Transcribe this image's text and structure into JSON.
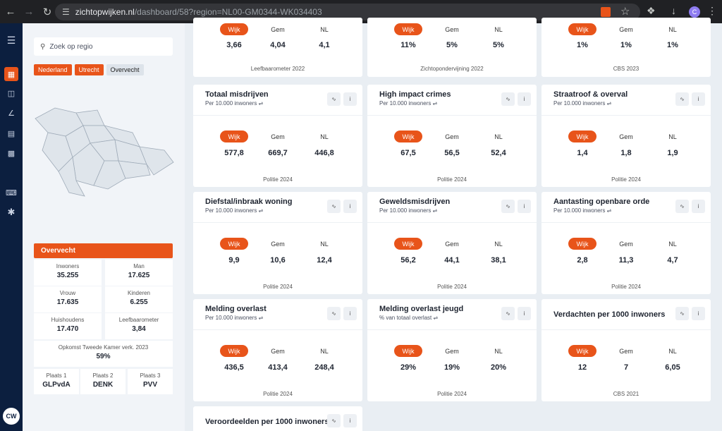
{
  "browser": {
    "url_host": "zichtopwijken.nl",
    "url_path": "/dashboard/58?region=NL00-GM0344-WK034403",
    "profile_initial": "C"
  },
  "rail": {
    "avatar": "CW"
  },
  "sidebar": {
    "search_placeholder": "Zoek op regio",
    "breadcrumbs": [
      "Nederland",
      "Utrecht",
      "Overvecht"
    ],
    "region_title": "Overvecht",
    "stats": [
      {
        "label": "Inwoners",
        "value": "35.255"
      },
      {
        "label": "Man",
        "value": "17.625"
      },
      {
        "label": "Vrouw",
        "value": "17.635"
      },
      {
        "label": "Kinderen",
        "value": "6.255"
      },
      {
        "label": "Huishoudens",
        "value": "17.470"
      },
      {
        "label": "Leefbaarometer",
        "value": "3,84"
      }
    ],
    "election": {
      "label": "Opkomst Tweede Kamer verk. 2023",
      "value": "59%"
    },
    "places": [
      {
        "label": "Plaats 1",
        "value": "GLPvdA"
      },
      {
        "label": "Plaats 2",
        "value": "DENK"
      },
      {
        "label": "Plaats 3",
        "value": "PVV"
      }
    ]
  },
  "columns": {
    "wijk": "Wijk",
    "gem": "Gem",
    "nl": "NL"
  },
  "cards": [
    {
      "title": "",
      "subtitle": "",
      "wijk": "3,66",
      "gem": "4,04",
      "nl": "4,1",
      "source": "Leefbaarometer 2022"
    },
    {
      "title": "",
      "subtitle": "",
      "wijk": "11%",
      "gem": "5%",
      "nl": "5%",
      "source": "Zichtopondervijning 2022"
    },
    {
      "title": "",
      "subtitle": "",
      "wijk": "1%",
      "gem": "1%",
      "nl": "1%",
      "source": "CBS 2023"
    },
    {
      "title": "Totaal misdrijven",
      "subtitle": "Per 10.000 inwoners",
      "wijk": "577,8",
      "gem": "669,7",
      "nl": "446,8",
      "source": "Politie 2024"
    },
    {
      "title": "High impact crimes",
      "subtitle": "Per 10.000 inwoners",
      "wijk": "67,5",
      "gem": "56,5",
      "nl": "52,4",
      "source": "Politie 2024"
    },
    {
      "title": "Straatroof & overval",
      "subtitle": "Per 10.000 inwoners",
      "wijk": "1,4",
      "gem": "1,8",
      "nl": "1,9",
      "source": "Politie 2024"
    },
    {
      "title": "Diefstal/inbraak woning",
      "subtitle": "Per 10.000 inwoners",
      "wijk": "9,9",
      "gem": "10,6",
      "nl": "12,4",
      "source": "Politie 2024"
    },
    {
      "title": "Geweldsmisdrijven",
      "subtitle": "Per 10.000 inwoners",
      "wijk": "56,2",
      "gem": "44,1",
      "nl": "38,1",
      "source": "Politie 2024"
    },
    {
      "title": "Aantasting openbare orde",
      "subtitle": "Per 10.000 inwoners",
      "wijk": "2,8",
      "gem": "11,3",
      "nl": "4,7",
      "source": "Politie 2024"
    },
    {
      "title": "Melding overlast",
      "subtitle": "Per 10.000 inwoners",
      "wijk": "436,5",
      "gem": "413,4",
      "nl": "248,4",
      "source": "Politie 2024"
    },
    {
      "title": "Melding overlast jeugd",
      "subtitle": "% van totaal overlast",
      "wijk": "29%",
      "gem": "19%",
      "nl": "20%",
      "source": "Politie 2024"
    },
    {
      "title": "Verdachten per 1000 inwoners",
      "subtitle": "",
      "wijk": "12",
      "gem": "7",
      "nl": "6,05",
      "source": "CBS 2021"
    },
    {
      "title": "Veroordeelden per 1000 inwoners",
      "subtitle": "",
      "wijk": "",
      "gem": "",
      "nl": "",
      "source": ""
    }
  ]
}
